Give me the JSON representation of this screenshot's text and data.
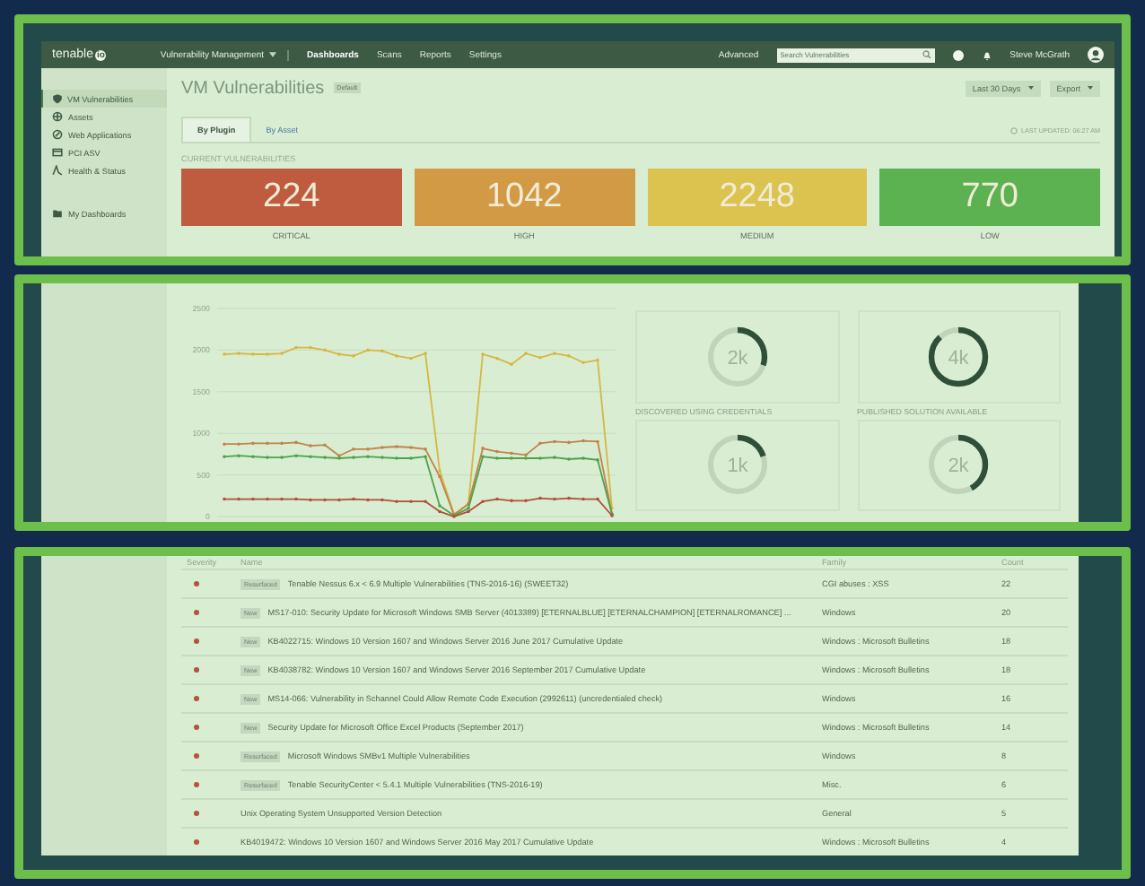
{
  "topbar": {
    "logo": "tenable",
    "logo_badge": "io",
    "product": "Vulnerability Management",
    "nav": [
      {
        "label": "Dashboards",
        "selected": true
      },
      {
        "label": "Scans",
        "selected": false
      },
      {
        "label": "Reports",
        "selected": false
      },
      {
        "label": "Settings",
        "selected": false
      }
    ],
    "advanced": "Advanced",
    "search": {
      "placeholder": "Search Vulnerabilities"
    },
    "user": "Steve McGrath"
  },
  "sidebar": {
    "items": [
      {
        "label": "VM Vulnerabilities",
        "kind": "shield",
        "selected": true
      },
      {
        "label": "Assets",
        "kind": "globe",
        "selected": false
      },
      {
        "label": "Web Applications",
        "kind": "target",
        "selected": false
      },
      {
        "label": "PCI ASV",
        "kind": "card",
        "selected": false
      },
      {
        "label": "Health & Status",
        "kind": "pulse",
        "selected": false
      }
    ],
    "dashboards": [
      {
        "label": "My Dashboards",
        "kind": "folder",
        "selected": false
      }
    ]
  },
  "page": {
    "title": "VM Vulnerabilities",
    "tag": "Default",
    "range_button": "Last 30 Days",
    "export_button": "Export",
    "tabs": [
      {
        "label": "By Plugin",
        "selected": true
      },
      {
        "label": "By Asset",
        "selected": false
      }
    ],
    "last_updated": "LAST UPDATED: 06:27 AM",
    "section_title": "CURRENT VULNERABILITIES",
    "severities": [
      {
        "count": "224",
        "label": "CRITICAL",
        "color": "#bf5b3e"
      },
      {
        "count": "1042",
        "label": "HIGH",
        "color": "#d39a45"
      },
      {
        "count": "2248",
        "label": "MEDIUM",
        "color": "#dcc350"
      },
      {
        "count": "770",
        "label": "LOW",
        "color": "#5cb150"
      }
    ]
  },
  "trend": {
    "chart_data": {
      "type": "line",
      "grid": true,
      "yticks": [
        0,
        500,
        1000,
        1500,
        2000,
        2500
      ],
      "ylim": [
        0,
        2500
      ],
      "series": [
        {
          "color": "#d7b740",
          "values": [
            1950,
            1960,
            1950,
            1950,
            1960,
            2030,
            2030,
            2000,
            1950,
            1930,
            2000,
            1990,
            1930,
            1900,
            1960,
            550,
            30,
            150,
            1950,
            1900,
            1830,
            1960,
            1910,
            1960,
            1930,
            1850,
            1880,
            100
          ]
        },
        {
          "color": "#c4824a",
          "values": [
            870,
            870,
            880,
            880,
            880,
            890,
            850,
            860,
            730,
            810,
            810,
            830,
            840,
            830,
            810,
            480,
            20,
            150,
            820,
            780,
            760,
            740,
            880,
            900,
            890,
            910,
            900,
            30
          ]
        },
        {
          "color": "#4da24a",
          "values": [
            720,
            730,
            720,
            710,
            710,
            730,
            720,
            710,
            700,
            710,
            720,
            710,
            700,
            700,
            720,
            130,
            10,
            100,
            720,
            700,
            700,
            700,
            700,
            710,
            690,
            700,
            680,
            30
          ]
        },
        {
          "color": "#b0503a",
          "values": [
            210,
            210,
            210,
            210,
            210,
            210,
            200,
            200,
            200,
            210,
            200,
            200,
            180,
            180,
            180,
            60,
            0,
            60,
            180,
            210,
            190,
            190,
            220,
            210,
            220,
            210,
            210,
            10
          ]
        }
      ]
    }
  },
  "donuts": [
    {
      "value": "2k",
      "level": 0.3
    },
    {
      "value": "4k",
      "level": 0.88
    },
    {
      "title": "DISCOVERED USING CREDENTIALS",
      "value": "1k",
      "level": 0.2
    },
    {
      "title": "PUBLISHED SOLUTION AVAILABLE",
      "value": "2k",
      "level": 0.42
    }
  ],
  "table": {
    "columns": [
      "Severity",
      "Name",
      "Family",
      "Count"
    ],
    "rows": [
      {
        "color": "#b5523c",
        "badge": "Resurfaced",
        "name": "Tenable Nessus 6.x < 6.9 Multiple Vulnerabilities (TNS-2016-16) (SWEET32)",
        "family": "CGI abuses : XSS",
        "count": "22"
      },
      {
        "color": "#b5523c",
        "badge": "New",
        "name": "MS17-010: Security Update for Microsoft Windows SMB Server (4013389) [ETERNALBLUE] [ETERNALCHAMPION] [ETERNALROMANCE] ...",
        "family": "Windows",
        "count": "20"
      },
      {
        "color": "#b5523c",
        "badge": "New",
        "name": "KB4022715: Windows 10 Version 1607 and Windows Server 2016 June 2017 Cumulative Update",
        "family": "Windows : Microsoft Bulletins",
        "count": "18"
      },
      {
        "color": "#b5523c",
        "badge": "New",
        "name": "KB4038782: Windows 10 Version 1607 and Windows Server 2016 September 2017 Cumulative Update",
        "family": "Windows : Microsoft Bulletins",
        "count": "18"
      },
      {
        "color": "#b5523c",
        "badge": "New",
        "name": "MS14-066: Vulnerability in Schannel Could Allow Remote Code Execution (2992611) (uncredentialed check)",
        "family": "Windows",
        "count": "16"
      },
      {
        "color": "#b5523c",
        "badge": "New",
        "name": "Security Update for Microsoft Office Excel Products (September 2017)",
        "family": "Windows : Microsoft Bulletins",
        "count": "14"
      },
      {
        "color": "#b5523c",
        "badge": "Resurfaced",
        "name": "Microsoft Windows SMBv1 Multiple Vulnerabilities",
        "family": "Windows",
        "count": "8"
      },
      {
        "color": "#b5523c",
        "badge": "Resurfaced",
        "name": "Tenable SecurityCenter < 5.4.1 Multiple Vulnerabilities (TNS-2016-19)",
        "family": "Misc.",
        "count": "6"
      },
      {
        "color": "#b5523c",
        "name": "Unix Operating System Unsupported Version Detection",
        "family": "General",
        "count": "5"
      },
      {
        "color": "#b5523c",
        "name": "KB4019472: Windows 10 Version 1607 and Windows Server 2016 May 2017 Cumulative Update",
        "family": "Windows : Microsoft Bulletins",
        "count": "4"
      }
    ]
  }
}
